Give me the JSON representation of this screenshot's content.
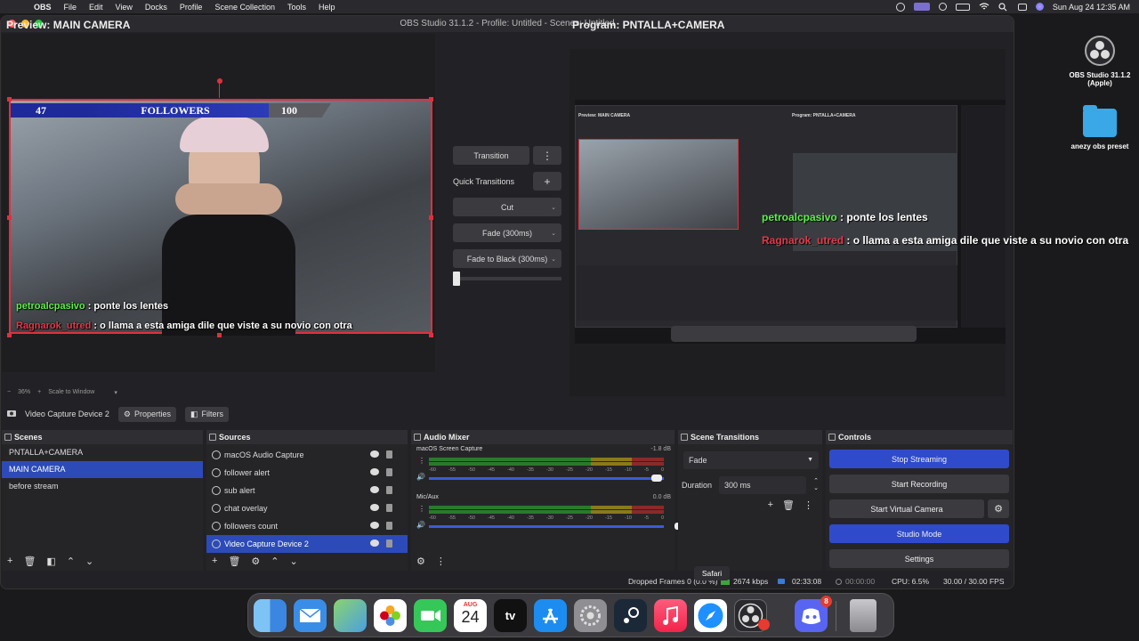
{
  "menubar": {
    "app_name": "OBS",
    "items": [
      "File",
      "Edit",
      "View",
      "Docks",
      "Profile",
      "Scene Collection",
      "Tools",
      "Help"
    ],
    "datetime": "Sun Aug 24  12:35 AM"
  },
  "window": {
    "title": "OBS Studio 31.1.2 - Profile: Untitled - Scenes: Untitled",
    "preview_label": "Preview: MAIN CAMERA",
    "program_label": "Program: PNTALLA+CAMERA"
  },
  "overlay": {
    "followers_current": "47",
    "followers_label": "FOLLOWERS",
    "followers_goal": "100"
  },
  "chat": [
    {
      "user": "petroalcpasivo",
      "message": " : ponte los lentes"
    },
    {
      "user": "Ragnarok_utred",
      "message": " : o llama a esta amiga dile que viste a su novio con otra"
    }
  ],
  "preview_zoom": {
    "minus": "−",
    "zoom": "36%",
    "plus": "+",
    "mode": "Scale to Window"
  },
  "transitions": {
    "transition_button": "Transition",
    "quick_label": "Quick Transitions",
    "quick_items": [
      "Cut",
      "Fade (300ms)",
      "Fade to Black (300ms)"
    ]
  },
  "source_toolbar": {
    "source_name": "Video Capture Device 2",
    "properties": "Properties",
    "filters": "Filters"
  },
  "docks": {
    "scenes": {
      "title": "Scenes",
      "items": [
        "PNTALLA+CAMERA",
        "MAIN CAMERA",
        "before stream"
      ],
      "selected_index": 1
    },
    "sources": {
      "title": "Sources",
      "items": [
        "macOS Audio Capture",
        "follower alert",
        "sub alert",
        "chat overlay",
        "followers count",
        "Video Capture Device 2"
      ],
      "selected_index": 5
    },
    "audio_mixer": {
      "title": "Audio Mixer",
      "tracks": [
        {
          "name": "macOS Screen Capture",
          "db": "-1.8 dB"
        },
        {
          "name": "Mic/Aux",
          "db": "0.0 dB"
        }
      ],
      "scale": [
        "-60",
        "-55",
        "-50",
        "-45",
        "-40",
        "-35",
        "-30",
        "-25",
        "-20",
        "-15",
        "-10",
        "-5",
        "0"
      ]
    },
    "scene_transitions": {
      "title": "Scene Transitions",
      "selected": "Fade",
      "duration_label": "Duration",
      "duration_value": "300 ms"
    },
    "controls": {
      "title": "Controls",
      "stop_streaming": "Stop Streaming",
      "start_recording": "Start Recording",
      "start_virtual_camera": "Start Virtual Camera",
      "studio_mode": "Studio Mode",
      "settings": "Settings"
    }
  },
  "statusbar": {
    "dropped_frames": "Dropped Frames 0 (0.0 %)",
    "bitrate": "2674 kbps",
    "stream_time": "02:33:08",
    "rec_time": "00:00:00",
    "cpu": "CPU: 6.5%",
    "fps": "30.00 / 30.00 FPS"
  },
  "desktop": {
    "icon1_label": "OBS Studio 31.1.2 (Apple)",
    "icon2_label": "anezy obs preset"
  },
  "dock": {
    "tooltip": "Safari",
    "calendar_month": "AUG",
    "calendar_day": "24",
    "discord_badge": "8",
    "tv_label": "tv"
  },
  "colors": {
    "accent": "#2f4bcc",
    "selection": "#2c4bb8",
    "bounding_box": "#e03040"
  }
}
